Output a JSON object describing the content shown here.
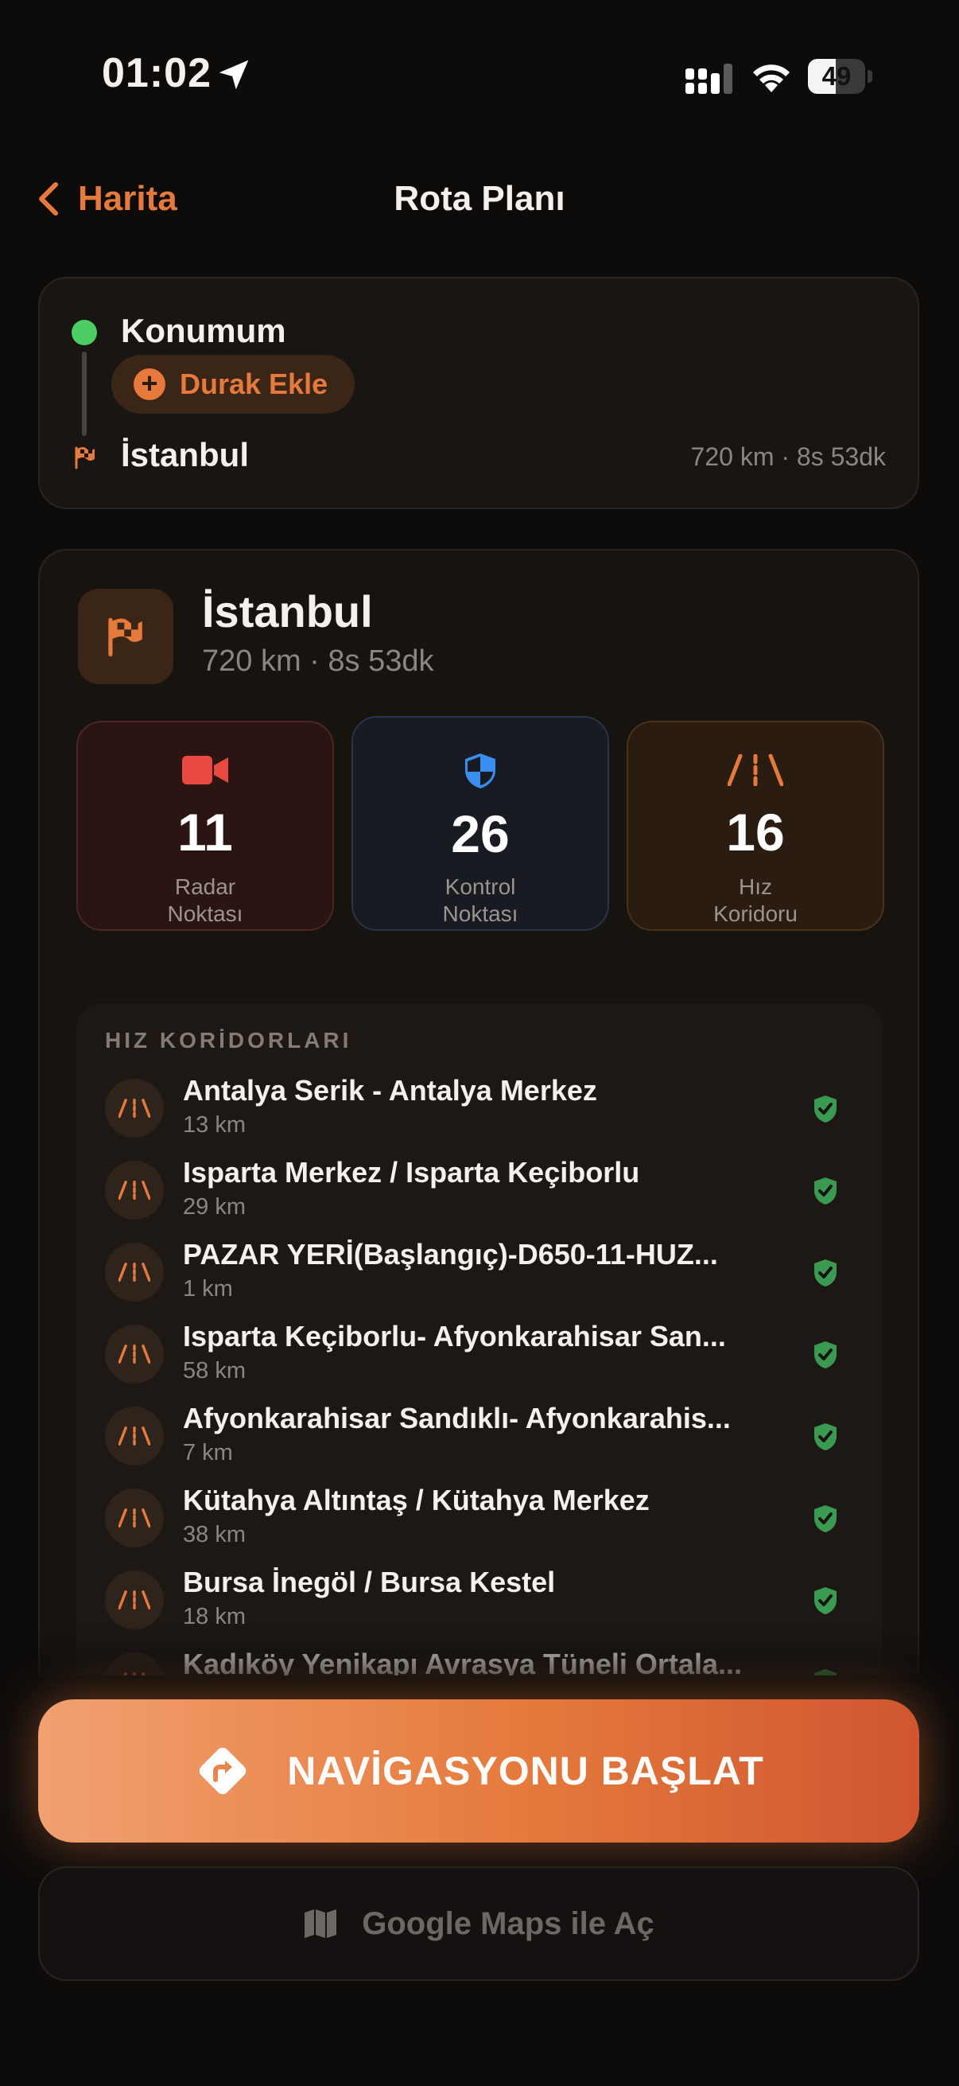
{
  "status_bar": {
    "time": "01:02",
    "battery": "49",
    "battery_level": 0.49
  },
  "nav": {
    "back_label": "Harita",
    "title": "Rota Planı"
  },
  "route": {
    "origin": "Konumum",
    "add_stop_label": "Durak Ekle",
    "destination": "İstanbul",
    "summary": "720 km · 8s 53dk"
  },
  "destination_card": {
    "name": "İstanbul",
    "meta": "720 km  ·  8s 53dk",
    "stats": [
      {
        "value": "11",
        "label_line1": "Radar",
        "label_line2": "Noktası",
        "color": "#e84a42"
      },
      {
        "value": "26",
        "label_line1": "Kontrol",
        "label_line2": "Noktası",
        "color": "#3b8cf0"
      },
      {
        "value": "16",
        "label_line1": "Hız",
        "label_line2": "Koridoru",
        "color": "#e57a3c"
      }
    ]
  },
  "corridors": {
    "heading": "HIZ KORİDORLARI",
    "items": [
      {
        "name": "Antalya Serik - Antalya Merkez",
        "distance": "13 km"
      },
      {
        "name": "Isparta Merkez / Isparta Keçiborlu",
        "distance": "29 km"
      },
      {
        "name": "PAZAR YERİ(Başlangıç)-D650-11-HUZ...",
        "distance": "1 km"
      },
      {
        "name": "Isparta Keçiborlu- Afyonkarahisar San...",
        "distance": "58 km"
      },
      {
        "name": "Afyonkarahisar Sandıklı- Afyonkarahis...",
        "distance": "7 km"
      },
      {
        "name": "Kütahya Altıntaş / Kütahya Merkez",
        "distance": "38 km"
      },
      {
        "name": "Bursa İnegöl / Bursa Kestel",
        "distance": "18 km"
      },
      {
        "name": "Kadıköy Yenikapı Avrasya Tüneli Ortala...",
        "distance": ""
      }
    ]
  },
  "actions": {
    "start_label": "NAVİGASYONU BAŞLAT",
    "maps_label": "Google Maps ile Aç"
  },
  "colors": {
    "accent": "#e57a3c",
    "green": "#4ccd63",
    "background": "#0e0c0b"
  }
}
